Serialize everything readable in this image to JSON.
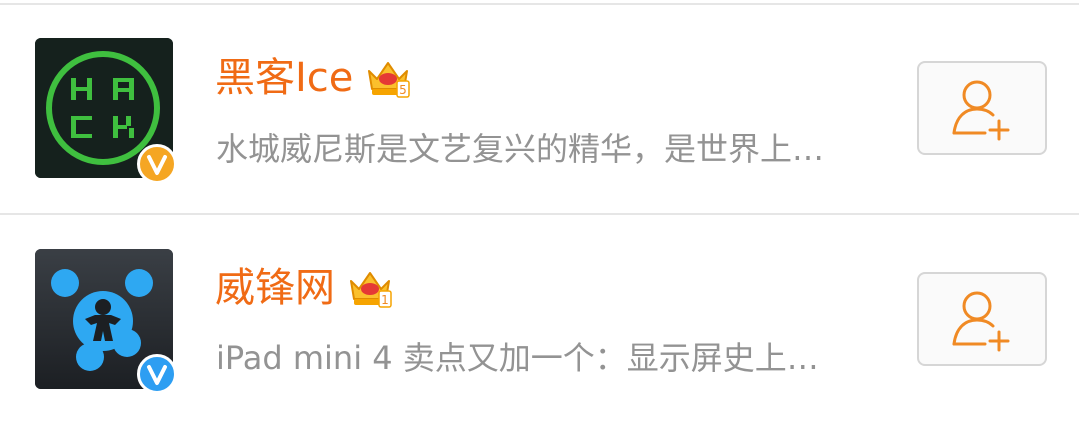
{
  "list": {
    "items": [
      {
        "name": "黑客Ice",
        "description": "水城威尼斯是文艺复兴的精华，是世界上…",
        "avatar_icon": "hack-logo",
        "badge_color": "#f5a623",
        "badge_icon": "verified-v-icon",
        "crown_icon": "crown-level-icon",
        "crown_level": "5",
        "follow_icon": "add-user-icon"
      },
      {
        "name": "威锋网",
        "description": "iPad mini 4 卖点又加一个：显示屏史上…",
        "avatar_icon": "weiphone-logo",
        "badge_color": "#2d9ef2",
        "badge_icon": "verified-v-icon",
        "crown_icon": "crown-level-icon",
        "crown_level": "1",
        "follow_icon": "add-user-icon"
      }
    ]
  },
  "colors": {
    "name": "#f06b15",
    "description": "#939393",
    "accent": "#f08a24",
    "divider": "#e6e6e6"
  }
}
